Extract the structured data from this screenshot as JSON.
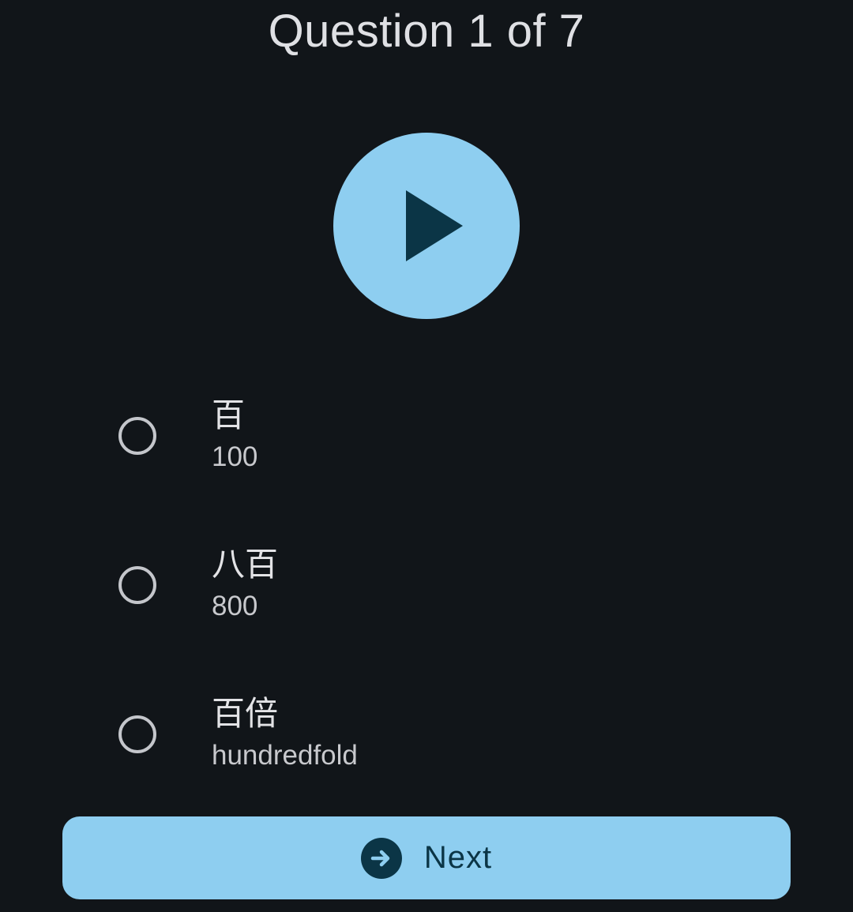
{
  "header": {
    "title": "Question 1 of 7"
  },
  "player": {
    "icon": "play-icon"
  },
  "options": [
    {
      "word": "百",
      "meaning": "100"
    },
    {
      "word": "八百",
      "meaning": "800"
    },
    {
      "word": "百倍",
      "meaning": "hundredfold"
    }
  ],
  "footer": {
    "next_label": "Next",
    "next_icon": "arrow-right-circle-icon"
  },
  "colors": {
    "background": "#111519",
    "accent": "#8ecef0",
    "on_accent": "#0b3546",
    "text_primary": "#e3e3e6",
    "text_secondary": "#c8c9cd",
    "radio_outline": "#c4c6cb"
  }
}
